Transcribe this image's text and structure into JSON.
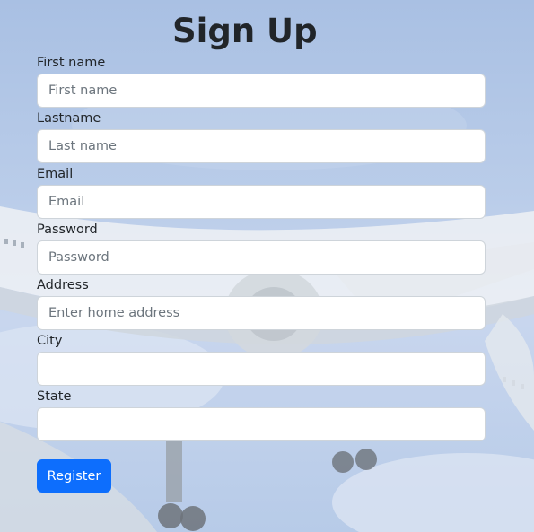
{
  "page": {
    "title": "Sign Up"
  },
  "form": {
    "fields": [
      {
        "label": "First name",
        "placeholder": "First name",
        "value": ""
      },
      {
        "label": "Lastname",
        "placeholder": "Last name",
        "value": ""
      },
      {
        "label": "Email",
        "placeholder": "Email",
        "value": ""
      },
      {
        "label": "Password",
        "placeholder": "Password",
        "value": ""
      },
      {
        "label": "Address",
        "placeholder": "Enter home address",
        "value": ""
      },
      {
        "label": "City",
        "placeholder": "",
        "value": ""
      },
      {
        "label": "State",
        "placeholder": "",
        "value": ""
      }
    ],
    "submit_label": "Register"
  },
  "colors": {
    "accent": "#0d6efd",
    "text": "#212529",
    "placeholder": "#6c757d",
    "input_border": "#ced4da"
  },
  "background": {
    "image": "airplane-photo"
  }
}
